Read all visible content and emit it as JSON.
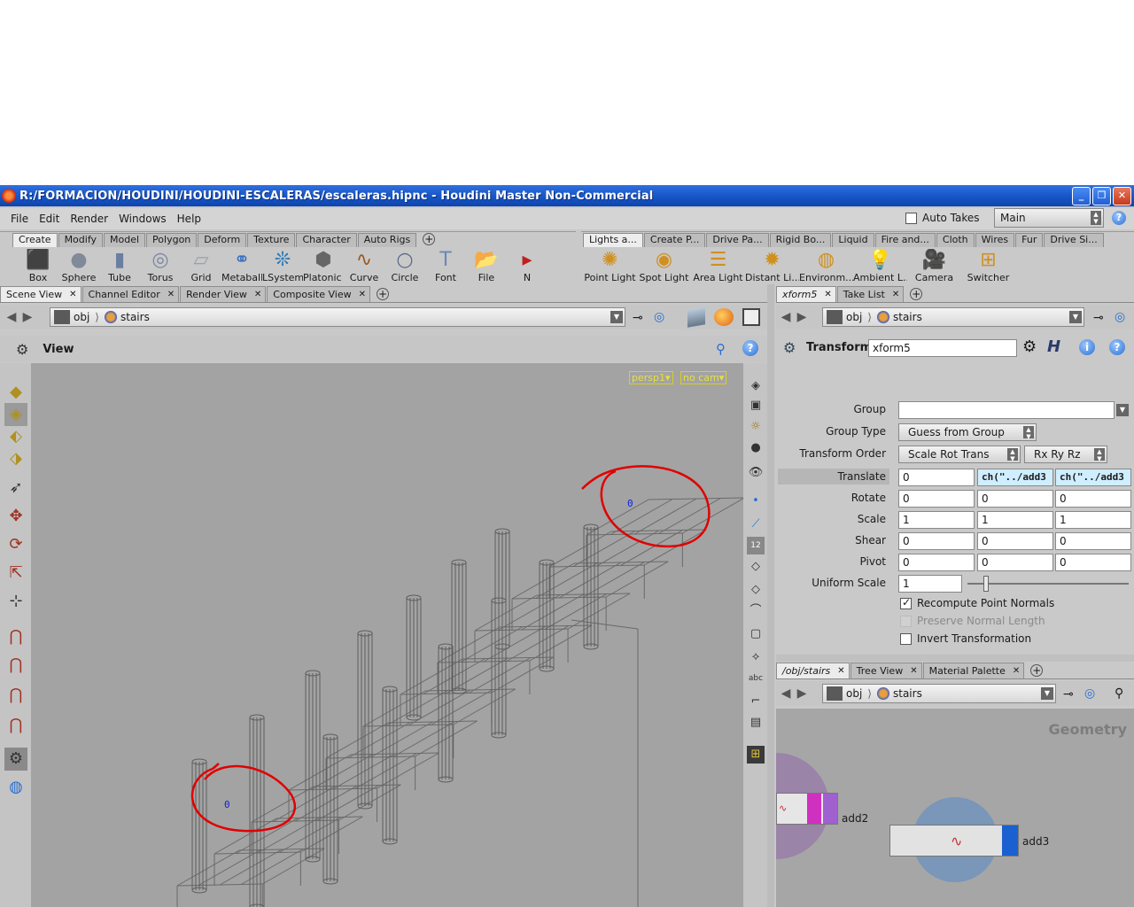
{
  "window": {
    "title": "R:/FORMACION/HOUDINI/HOUDINI-ESCALERAS/escaleras.hipnc - Houdini Master Non-Commercial",
    "minimize": "_",
    "restore": "❐",
    "close": "✕"
  },
  "menu": {
    "items": [
      "File",
      "Edit",
      "Render",
      "Windows",
      "Help"
    ]
  },
  "auto_takes": {
    "label": "Auto Takes",
    "checked": false
  },
  "take_select": {
    "value": "Main"
  },
  "shelf_left": {
    "tabs": [
      "Create",
      "Modify",
      "Model",
      "Polygon",
      "Deform",
      "Texture",
      "Character",
      "Auto Rigs"
    ],
    "active": "Create",
    "tools": [
      {
        "label": "Box",
        "icon": "box-icon",
        "glyph": "⬛"
      },
      {
        "label": "Sphere",
        "icon": "sphere-icon",
        "glyph": "●"
      },
      {
        "label": "Tube",
        "icon": "tube-icon",
        "glyph": "▮"
      },
      {
        "label": "Torus",
        "icon": "torus-icon",
        "glyph": "◎"
      },
      {
        "label": "Grid",
        "icon": "grid-icon",
        "glyph": "▱"
      },
      {
        "label": "Metaball",
        "icon": "metaball-icon",
        "glyph": "⚭"
      },
      {
        "label": "LSystem",
        "icon": "lsystem-icon",
        "glyph": "❊"
      },
      {
        "label": "Platonic ...",
        "icon": "platonic-icon",
        "glyph": "⬢"
      },
      {
        "label": "Curve",
        "icon": "curve-icon",
        "glyph": "∿"
      },
      {
        "label": "Circle",
        "icon": "circle-icon",
        "glyph": "○"
      },
      {
        "label": "Font",
        "icon": "font-icon",
        "glyph": "T"
      },
      {
        "label": "File",
        "icon": "file-icon",
        "glyph": "📂"
      },
      {
        "label": "N",
        "icon": "more-icon",
        "glyph": "▸"
      }
    ]
  },
  "shelf_right": {
    "tabs": [
      "Lights a...",
      "Create P...",
      "Drive Pa...",
      "Rigid Bo...",
      "Liquid",
      "Fire and...",
      "Cloth",
      "Wires",
      "Fur",
      "Drive Si..."
    ],
    "active": "Lights a...",
    "tools": [
      {
        "label": "Point Light",
        "icon": "point-light-icon",
        "glyph": "✺"
      },
      {
        "label": "Spot Light",
        "icon": "spot-light-icon",
        "glyph": "◉"
      },
      {
        "label": "Area Light",
        "icon": "area-light-icon",
        "glyph": "☰"
      },
      {
        "label": "Distant Li...",
        "icon": "distant-light-icon",
        "glyph": "✹"
      },
      {
        "label": "Environm...",
        "icon": "environment-light-icon",
        "glyph": "◍"
      },
      {
        "label": "Ambient L...",
        "icon": "ambient-light-icon",
        "glyph": "💡"
      },
      {
        "label": "Camera",
        "icon": "camera-icon",
        "glyph": "🎥"
      },
      {
        "label": "Switcher",
        "icon": "switcher-icon",
        "glyph": "⊞"
      }
    ]
  },
  "left_pane": {
    "tabs": [
      {
        "label": "Scene View",
        "active": true
      },
      {
        "label": "Channel Editor",
        "active": false
      },
      {
        "label": "Render View",
        "active": false
      },
      {
        "label": "Composite View",
        "active": false
      }
    ],
    "path": [
      "obj",
      "stairs"
    ],
    "view_label": "View",
    "camera": "persp1▾",
    "cam_menu": "no cam▾",
    "markers": [
      "0",
      "0"
    ]
  },
  "param_pane": {
    "tabs": [
      {
        "label": "xform5",
        "active": true
      },
      {
        "label": "Take List",
        "active": false
      }
    ],
    "path": [
      "obj",
      "stairs"
    ],
    "node_type": "Transform",
    "node_name": "xform5",
    "group_label": "Group",
    "group_value": "",
    "group_type_label": "Group Type",
    "group_type_value": "Guess from Group",
    "transform_order_label": "Transform Order",
    "transform_order_value": "Scale Rot Trans",
    "rot_order_value": "Rx Ry Rz",
    "translate_label": "Translate",
    "translate": [
      "0",
      "ch(\"../add3",
      "ch(\"../add3"
    ],
    "rotate_label": "Rotate",
    "rotate": [
      "0",
      "0",
      "0"
    ],
    "scale_label": "Scale",
    "scale": [
      "1",
      "1",
      "1"
    ],
    "shear_label": "Shear",
    "shear": [
      "0",
      "0",
      "0"
    ],
    "pivot_label": "Pivot",
    "pivot": [
      "0",
      "0",
      "0"
    ],
    "uniform_scale_label": "Uniform Scale",
    "uniform_scale": "1",
    "uniform_scale_slider": 0.1,
    "recompute_label": "Recompute Point Normals",
    "recompute_checked": true,
    "preserve_label": "Preserve Normal Length",
    "invert_label": "Invert Transformation",
    "invert_checked": false
  },
  "network_pane": {
    "tabs": [
      {
        "label": "/obj/stairs",
        "active": true
      },
      {
        "label": "Tree View",
        "active": false
      },
      {
        "label": "Material Palette",
        "active": false
      }
    ],
    "path": [
      "obj",
      "stairs"
    ],
    "context_label": "Geometry",
    "nodes": [
      "add2",
      "add3"
    ]
  },
  "colors": {
    "viewport_bg": "#a3a3a3",
    "annotation_red": "#e00000",
    "marker_blue": "#1020e0",
    "expression_bg": "#cfeeff",
    "title_blue": "#1553c4"
  }
}
